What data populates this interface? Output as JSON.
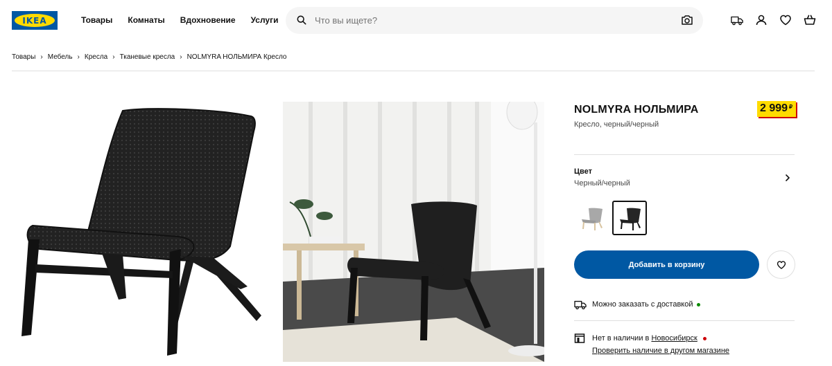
{
  "header": {
    "logo_text": "IKEA",
    "nav": [
      "Товары",
      "Комнаты",
      "Вдохновение",
      "Услуги"
    ],
    "search_placeholder": "Что вы ищете?",
    "icons": [
      "delivery-truck-icon",
      "user-icon",
      "heart-icon",
      "shopping-bag-icon"
    ]
  },
  "breadcrumb": [
    "Товары",
    "Мебель",
    "Кресла",
    "Тканевые кресла",
    "NOLMYRA НОЛЬМИРА Кресло"
  ],
  "product": {
    "title": "NOLMYRA НОЛЬМИРА",
    "subtitle": "Кресло, черный/черный",
    "price": "2 999",
    "currency": "₽",
    "color_label": "Цвет",
    "color_value": "Черный/черный",
    "add_to_cart": "Добавить в корзину",
    "delivery_text": "Можно заказать с доставкой",
    "stock_prefix": "Нет в наличии в",
    "stock_city": "Новосибирск",
    "check_other_store": "Проверить наличие в другом магазине"
  },
  "colors": {
    "brand_blue": "#0058a3",
    "brand_yellow": "#ffdb00",
    "price_shadow": "#cc0008",
    "available_dot": "#0a8a00",
    "unavailable_dot": "#cc0008"
  }
}
